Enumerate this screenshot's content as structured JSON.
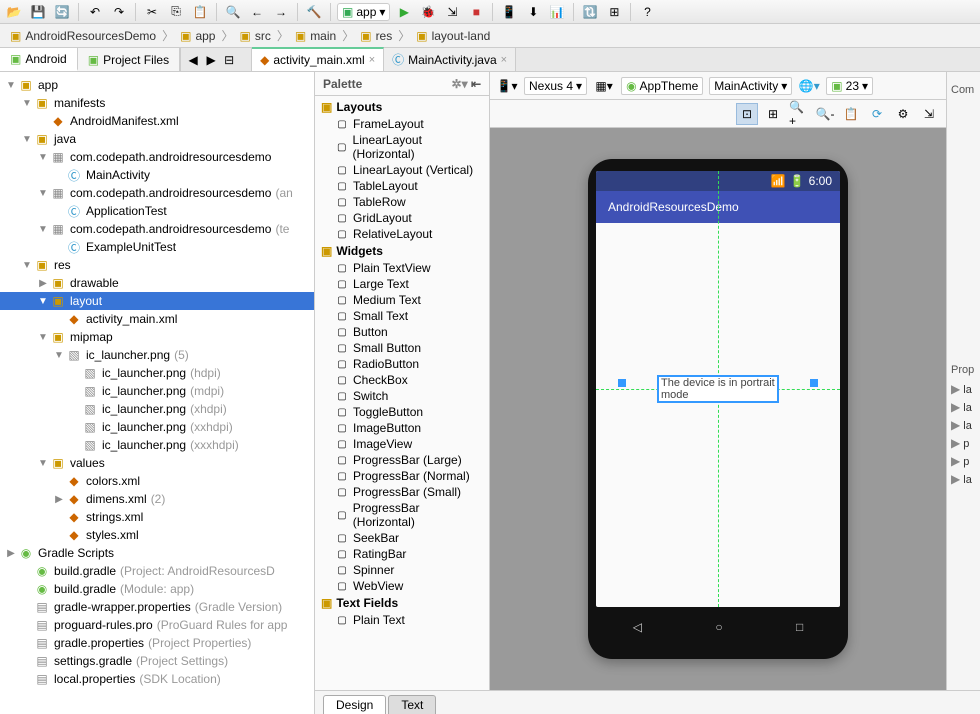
{
  "toolbar": {
    "module_combo": "app"
  },
  "breadcrumbs": [
    "AndroidResourcesDemo",
    "app",
    "src",
    "main",
    "res",
    "layout-land"
  ],
  "project_tabs": [
    {
      "label": "Android",
      "active": true
    },
    {
      "label": "Project Files",
      "active": false
    }
  ],
  "editor_tabs": [
    {
      "label": "activity_main.xml",
      "active": true,
      "icon": "xml"
    },
    {
      "label": "MainActivity.java",
      "active": false,
      "icon": "java"
    }
  ],
  "tree": [
    {
      "ind": 0,
      "arrow": "▼",
      "icon": "folder",
      "label": "app"
    },
    {
      "ind": 1,
      "arrow": "▼",
      "icon": "folder",
      "label": "manifests"
    },
    {
      "ind": 2,
      "arrow": "",
      "icon": "xml",
      "label": "AndroidManifest.xml"
    },
    {
      "ind": 1,
      "arrow": "▼",
      "icon": "folder",
      "label": "java"
    },
    {
      "ind": 2,
      "arrow": "▼",
      "icon": "pkg",
      "label": "com.codepath.androidresourcesdemo"
    },
    {
      "ind": 3,
      "arrow": "",
      "icon": "java",
      "label": "MainActivity"
    },
    {
      "ind": 2,
      "arrow": "▼",
      "icon": "pkg",
      "label": "com.codepath.androidresourcesdemo",
      "meta": "(an"
    },
    {
      "ind": 3,
      "arrow": "",
      "icon": "java",
      "label": "ApplicationTest"
    },
    {
      "ind": 2,
      "arrow": "▼",
      "icon": "pkg",
      "label": "com.codepath.androidresourcesdemo",
      "meta": "(te"
    },
    {
      "ind": 3,
      "arrow": "",
      "icon": "java",
      "label": "ExampleUnitTest"
    },
    {
      "ind": 1,
      "arrow": "▼",
      "icon": "folder",
      "label": "res"
    },
    {
      "ind": 2,
      "arrow": "▶",
      "icon": "folder",
      "label": "drawable"
    },
    {
      "ind": 2,
      "arrow": "▼",
      "icon": "folder",
      "label": "layout",
      "selected": true
    },
    {
      "ind": 3,
      "arrow": "",
      "icon": "xml",
      "label": "activity_main.xml"
    },
    {
      "ind": 2,
      "arrow": "▼",
      "icon": "folder",
      "label": "mipmap"
    },
    {
      "ind": 3,
      "arrow": "▼",
      "icon": "img",
      "label": "ic_launcher.png",
      "meta": "(5)"
    },
    {
      "ind": 4,
      "arrow": "",
      "icon": "img",
      "label": "ic_launcher.png",
      "meta": "(hdpi)"
    },
    {
      "ind": 4,
      "arrow": "",
      "icon": "img",
      "label": "ic_launcher.png",
      "meta": "(mdpi)"
    },
    {
      "ind": 4,
      "arrow": "",
      "icon": "img",
      "label": "ic_launcher.png",
      "meta": "(xhdpi)"
    },
    {
      "ind": 4,
      "arrow": "",
      "icon": "img",
      "label": "ic_launcher.png",
      "meta": "(xxhdpi)"
    },
    {
      "ind": 4,
      "arrow": "",
      "icon": "img",
      "label": "ic_launcher.png",
      "meta": "(xxxhdpi)"
    },
    {
      "ind": 2,
      "arrow": "▼",
      "icon": "folder",
      "label": "values"
    },
    {
      "ind": 3,
      "arrow": "",
      "icon": "xml",
      "label": "colors.xml"
    },
    {
      "ind": 3,
      "arrow": "▶",
      "icon": "xml",
      "label": "dimens.xml",
      "meta": "(2)"
    },
    {
      "ind": 3,
      "arrow": "",
      "icon": "xml",
      "label": "strings.xml"
    },
    {
      "ind": 3,
      "arrow": "",
      "icon": "xml",
      "label": "styles.xml"
    },
    {
      "ind": 0,
      "arrow": "▶",
      "icon": "gradle",
      "label": "Gradle Scripts"
    },
    {
      "ind": 1,
      "arrow": "",
      "icon": "gradle",
      "label": "build.gradle",
      "meta": "(Project: AndroidResourcesD"
    },
    {
      "ind": 1,
      "arrow": "",
      "icon": "gradle",
      "label": "build.gradle",
      "meta": "(Module: app)"
    },
    {
      "ind": 1,
      "arrow": "",
      "icon": "txt",
      "label": "gradle-wrapper.properties",
      "meta": "(Gradle Version)"
    },
    {
      "ind": 1,
      "arrow": "",
      "icon": "txt",
      "label": "proguard-rules.pro",
      "meta": "(ProGuard Rules for app"
    },
    {
      "ind": 1,
      "arrow": "",
      "icon": "txt",
      "label": "gradle.properties",
      "meta": "(Project Properties)"
    },
    {
      "ind": 1,
      "arrow": "",
      "icon": "txt",
      "label": "settings.gradle",
      "meta": "(Project Settings)"
    },
    {
      "ind": 1,
      "arrow": "",
      "icon": "txt",
      "label": "local.properties",
      "meta": "(SDK Location)"
    }
  ],
  "palette": {
    "title": "Palette",
    "groups": [
      {
        "title": "Layouts",
        "items": [
          "FrameLayout",
          "LinearLayout (Horizontal)",
          "LinearLayout (Vertical)",
          "TableLayout",
          "TableRow",
          "GridLayout",
          "RelativeLayout"
        ]
      },
      {
        "title": "Widgets",
        "items": [
          "Plain TextView",
          "Large Text",
          "Medium Text",
          "Small Text",
          "Button",
          "Small Button",
          "RadioButton",
          "CheckBox",
          "Switch",
          "ToggleButton",
          "ImageButton",
          "ImageView",
          "ProgressBar (Large)",
          "ProgressBar (Normal)",
          "ProgressBar (Small)",
          "ProgressBar (Horizontal)",
          "SeekBar",
          "RatingBar",
          "Spinner",
          "WebView"
        ]
      },
      {
        "title": "Text Fields",
        "items": [
          "Plain Text"
        ]
      }
    ]
  },
  "design_toolbar": {
    "device": "Nexus 4",
    "theme": "AppTheme",
    "activity": "MainActivity",
    "api": "23"
  },
  "device": {
    "time": "6:00",
    "app_title": "AndroidResourcesDemo",
    "selected_text": "The device is in portrait mode"
  },
  "bottom_tabs": [
    "Design",
    "Text"
  ],
  "right_panel": {
    "title": "Prop",
    "rows": [
      "la",
      "la",
      "la",
      "p",
      "p",
      "la"
    ],
    "section": "Com"
  }
}
